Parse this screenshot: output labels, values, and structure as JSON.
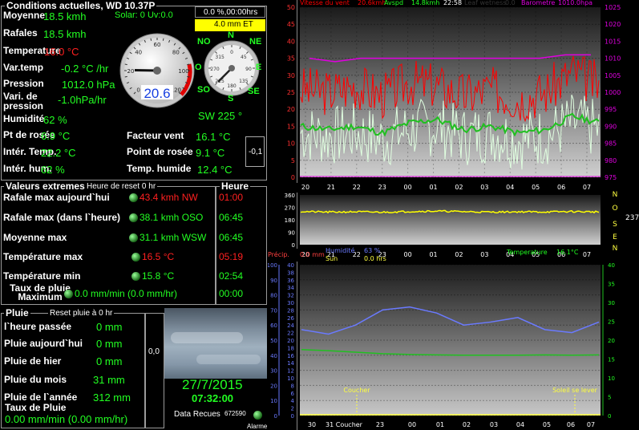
{
  "current": {
    "title": "Conditions actuelles, WD 10.37P",
    "solar": "Solar: 0 Uv:0.0",
    "rows": [
      {
        "label": "Moyenne",
        "value": "18.5 kmh"
      },
      {
        "label": "Rafales",
        "value": "18.5 kmh"
      },
      {
        "label": "Temperature",
        "value": "16.0 °C"
      },
      {
        "label": "Var.temp",
        "value": "-0.2 °C /hr"
      },
      {
        "label": "Pression",
        "value": "1012.0 hPa"
      },
      {
        "label": "Vari. de pression",
        "value": "-1.0hPa/hr"
      },
      {
        "label": "Humidité",
        "value": "62 %"
      },
      {
        "label": "Pt de rosée",
        "value": "6.9 °C"
      },
      {
        "label": "Intér. Temp.",
        "value": "22.2 °C"
      },
      {
        "label": "Intér. hum.",
        "value": "62 %"
      }
    ],
    "right_rows": [
      {
        "label": "Facteur vent",
        "value": "16.1 °C"
      },
      {
        "label": "Point de rosée",
        "value": "9.1 °C"
      },
      {
        "label": "Temp. humide",
        "value": "12.4 °C"
      }
    ],
    "rain_readout": "0.0 %,00:00hrs",
    "et_readout": "4.0 mm ET",
    "trend_value": "-0,1"
  },
  "gauges": {
    "temperature_value": "20.6",
    "temperature_scale": [
      "0",
      "20",
      "40",
      "60",
      "80",
      "100",
      "120"
    ],
    "temp_fraction": 0.17,
    "compass": {
      "N": "N",
      "NE": "NE",
      "E": "E",
      "SE": "SE",
      "S": "S",
      "SO": "SO",
      "O": "O",
      "NO": "NO"
    },
    "compass_scale": [
      "0",
      "45",
      "90",
      "135",
      "180",
      "225",
      "270",
      "315"
    ],
    "wind_direction_deg": 225,
    "wind_text": "SW  225 °"
  },
  "extremes": {
    "title": "Valeurs extremes",
    "reset": "Heure de reset 0 hr",
    "time_header": "Heure",
    "rows": [
      {
        "label": "Rafale max aujourd`hui",
        "value": "43.4 kmh  NW",
        "time": "01:00",
        "hot": true
      },
      {
        "label": "Rafale max (dans l`heure)",
        "value": "38.1 kmh OSO",
        "time": "06:45",
        "hot": false
      },
      {
        "label": "Moyenne max",
        "value": "31.1 kmh WSW",
        "time": "06:45",
        "hot": false
      },
      {
        "label": "Température max",
        "value": "16.5 °C",
        "time": "05:19",
        "hot": true
      },
      {
        "label": "Température min",
        "value": "15.8 °C",
        "time": "02:54",
        "hot": false
      },
      {
        "label": "Taux de pluie Maximum",
        "value": "0.0 mm/min (0.0 mm/hr)",
        "time": "00:00",
        "hot": false
      }
    ]
  },
  "rain": {
    "title": "Pluie",
    "reset": "Reset pluie à 0 hr",
    "rows": [
      {
        "label": "l`heure passée",
        "value": "0 mm"
      },
      {
        "label": "Pluie aujourd`hui",
        "value": "0 mm"
      },
      {
        "label": "Pluie de hier",
        "value": "0 mm"
      },
      {
        "label": "Pluie du mois",
        "value": "31 mm"
      },
      {
        "label": "Pluie de l`année",
        "value": "312 mm"
      }
    ],
    "rate_label": "Taux de Pluie",
    "rate_value": "0.00 mm/min (0.00 mm/hr)",
    "side_value": "0,0"
  },
  "clock": {
    "date": "27/7/2015",
    "time": "07:32:00",
    "data_label": "Data Recues",
    "data_count": "672590",
    "alarm_label": "Alarme"
  },
  "graph1": {
    "legend": {
      "wind": "Vitesse du vent",
      "wind_val": "20.6kmh",
      "avspd": "Avspd",
      "avspd_val": "14.8kmh",
      "time": "22:58",
      "leaf": "Leaf wetness",
      "leaf_val": "0.0",
      "baro": "Barometre",
      "baro_val": "1010.0hpa"
    },
    "colors": {
      "gust": "#ff0000",
      "avg": "#20c020",
      "low": "#e0ffe0",
      "baro": "#e000e0"
    },
    "left_ticks": [
      "50",
      "45",
      "40",
      "35",
      "30",
      "25",
      "20",
      "15",
      "10",
      "5",
      "0"
    ],
    "right_ticks": [
      "1025",
      "1020",
      "1015",
      "1010",
      "1005",
      "1000",
      "995",
      "990",
      "985",
      "980",
      "975"
    ],
    "x_ticks": [
      "20",
      "21",
      "22",
      "23",
      "00",
      "01",
      "02",
      "03",
      "04",
      "05",
      "06",
      "07"
    ],
    "chart_data": {
      "type": "line",
      "ylim": [
        0,
        50
      ],
      "y2lim": [
        975,
        1025
      ],
      "x": [
        "20",
        "21",
        "22",
        "23",
        "00",
        "01",
        "02",
        "03",
        "04",
        "05",
        "06",
        "07"
      ],
      "series": [
        {
          "values": [
            26,
            25,
            27,
            24,
            28,
            27,
            24,
            26,
            23,
            25,
            31,
            27
          ]
        },
        {
          "values": [
            15,
            14,
            15,
            13,
            16,
            17,
            14,
            15,
            13,
            14,
            18,
            16
          ]
        },
        {
          "values": [
            1010,
            1009,
            1010,
            1010,
            1010,
            1010,
            1010,
            1010,
            1010,
            1010,
            1011,
            1011
          ]
        }
      ]
    }
  },
  "graph2": {
    "ticks": [
      "360",
      "270",
      "180",
      "90",
      "0"
    ],
    "right_letters": [
      "N",
      "O",
      "S",
      "E",
      "N"
    ],
    "right_value": "237°",
    "x_ticks": [
      "20",
      "21",
      "22",
      "23",
      "00",
      "01",
      "02",
      "03",
      "04",
      "05",
      "06",
      "07"
    ],
    "color": "#ffff00",
    "chart_data": {
      "type": "line",
      "ylim": [
        0,
        360
      ],
      "x": [
        "20",
        "21",
        "22",
        "23",
        "00",
        "01",
        "02",
        "03",
        "04",
        "05",
        "06",
        "07"
      ],
      "series": [
        {
          "values": [
            240,
            236,
            238,
            235,
            240,
            243,
            239,
            236,
            238,
            237,
            240,
            237
          ]
        }
      ]
    }
  },
  "graph3": {
    "legend": {
      "precip": "Précip.",
      "precip_val": "0.0 mm",
      "humid": "Humidité",
      "humid_val": "63 %",
      "sun": "Sun",
      "sun_val": "0.0 hrs",
      "temp": "Temperature",
      "temp_val": "16.1°C"
    },
    "left_ticks": [
      "100",
      "90",
      "80",
      "70",
      "60",
      "50",
      "40",
      "30",
      "20",
      "10",
      "0"
    ],
    "mid_ticks": [
      "40",
      "38",
      "36",
      "34",
      "32",
      "30",
      "28",
      "26",
      "24",
      "22",
      "20",
      "18",
      "16",
      "14",
      "12",
      "10",
      "8",
      "6",
      "4",
      "2",
      "0"
    ],
    "right_ticks": [
      "40",
      "35",
      "30",
      "25",
      "20",
      "15",
      "10",
      "5",
      "0"
    ],
    "x_ticks": [
      "30",
      "31 Coucher",
      "23",
      "00",
      "01",
      "02",
      "03",
      "04",
      "05",
      "06",
      "07"
    ],
    "coucher": "Coucher",
    "lever": "Soleil se lever",
    "colors": {
      "humid": "#6a7aff",
      "temp": "#20c020",
      "precip": "#ffff40"
    },
    "chart_data": {
      "type": "line",
      "ylim": [
        0,
        100
      ],
      "y2lim": [
        0,
        40
      ],
      "x": [
        "20",
        "21",
        "22",
        "23",
        "00",
        "01",
        "02",
        "03",
        "04",
        "05",
        "06",
        "07"
      ],
      "series": [
        {
          "values": [
            57,
            54,
            60,
            70,
            72,
            68,
            60,
            62,
            65,
            57,
            55,
            62
          ]
        },
        {
          "values": [
            17.5,
            17.2,
            16.8,
            16.4,
            16.2,
            16.1,
            16.0,
            16.0,
            16.0,
            16.1,
            16.0,
            16.1
          ]
        }
      ]
    }
  }
}
